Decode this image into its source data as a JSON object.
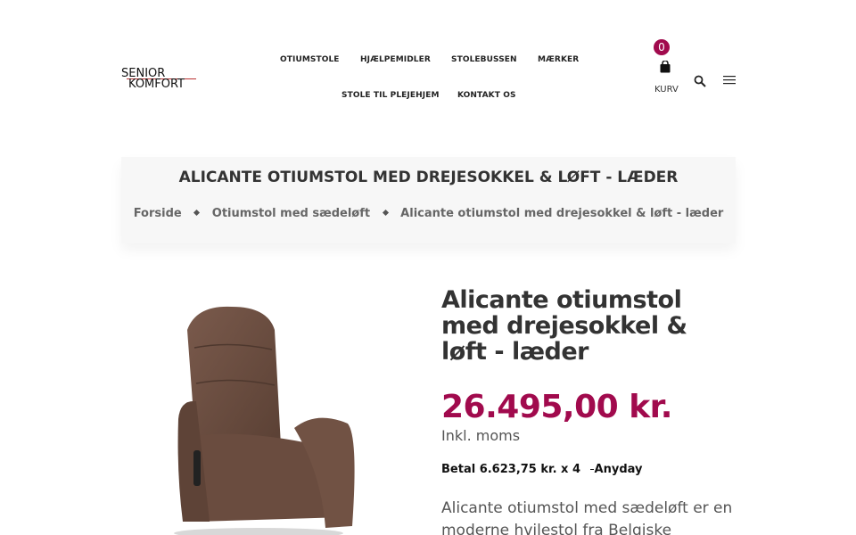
{
  "header": {
    "logo": {
      "line1": "SENIOR",
      "line2": "KOMFORT"
    },
    "nav": [
      {
        "label": "OTIUMSTOLE"
      },
      {
        "label": "HJÆLPEMIDLER"
      },
      {
        "label": "STOLEBUSSEN"
      },
      {
        "label": "MÆRKER"
      },
      {
        "label": "STOLE TIL PLEJEHJEM"
      },
      {
        "label": "KONTAKT OS"
      }
    ],
    "cart": {
      "count": "0",
      "label": "KURV",
      "icon": "shopping-bag-icon"
    },
    "search_icon": "search-icon",
    "menu_icon": "hamburger-menu-icon"
  },
  "titlebar": {
    "title": "ALICANTE OTIUMSTOL MED DREJESOKKEL & LØFT - LÆDER",
    "breadcrumbs": [
      {
        "label": "Forside"
      },
      {
        "label": "Otiumstol med sædeløft"
      },
      {
        "label": "Alicante otiumstol med drejesokkel & løft - læder"
      }
    ]
  },
  "product": {
    "title": "Alicante otiumstol med drejesokkel & løft - læder",
    "price": "26.495,00 kr.",
    "vat_note": "Inkl. moms",
    "installment": "Betal 6.623,75 kr. x 4",
    "installment_provider": "Anyday",
    "description": "Alicante otiumstol med sædeløft er en moderne hvilestol fra Belgiske",
    "image": "brown-leather-recliner-chair"
  },
  "colors": {
    "accent": "#a10a4d",
    "title_bar_bg": "#f7f7f7",
    "text_dark": "#333333"
  }
}
